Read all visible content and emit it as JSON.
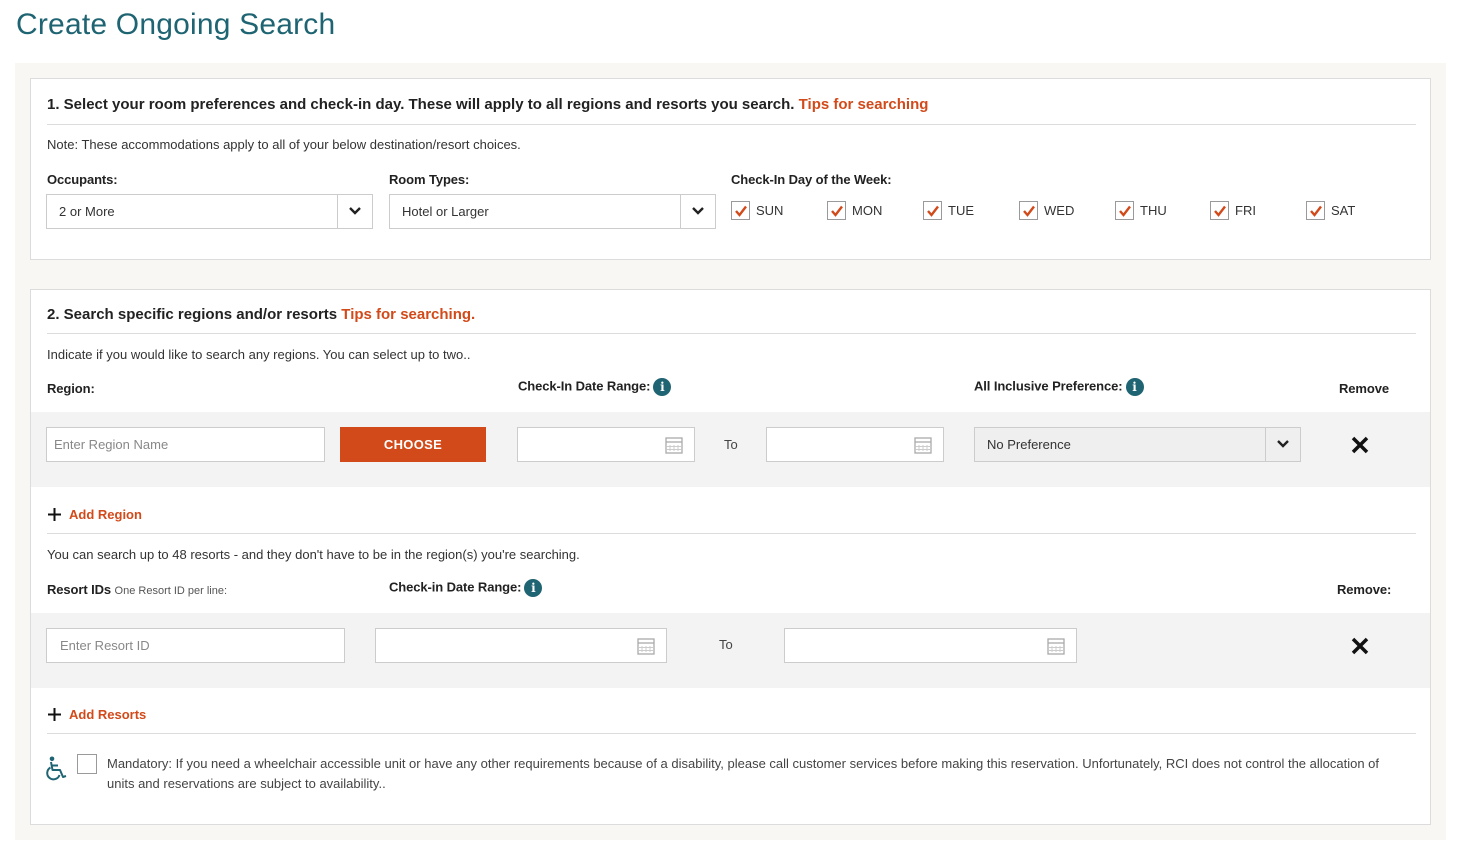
{
  "page": {
    "title": "Create Ongoing Search"
  },
  "section1": {
    "heading": "1. Select your room preferences and check-in day. These will apply to all regions and resorts you search.",
    "tips_link": "Tips for searching",
    "note": "Note: These accommodations apply to all of your below destination/resort choices.",
    "occupants": {
      "label": "Occupants:",
      "value": "2 or More"
    },
    "room_types": {
      "label": "Room Types:",
      "value": "Hotel or Larger"
    },
    "checkin_days": {
      "label": "Check-In Day of the Week:",
      "days": [
        {
          "label": "SUN",
          "checked": true
        },
        {
          "label": "MON",
          "checked": true
        },
        {
          "label": "TUE",
          "checked": true
        },
        {
          "label": "WED",
          "checked": true
        },
        {
          "label": "THU",
          "checked": true
        },
        {
          "label": "FRI",
          "checked": true
        },
        {
          "label": "SAT",
          "checked": true
        }
      ]
    }
  },
  "section2": {
    "heading": "2. Search specific regions and/or resorts",
    "tips_link": "Tips for searching.",
    "region_note": "Indicate if you would like to search any regions. You can select up to two..",
    "region_label": "Region:",
    "checkin_range_label": "Check-In Date Range:",
    "all_inclusive_label": "All Inclusive Preference:",
    "remove_label": "Remove",
    "region_placeholder": "Enter Region Name",
    "choose_button": "CHOOSE",
    "to_label": "To",
    "all_inclusive_value": "No Preference",
    "add_region": "Add Region",
    "resort_note": "You can search up to 48 resorts - and they don't have to be in the region(s) you're searching.",
    "resort_ids_label": "Resort IDs",
    "resort_ids_sub": "One Resort ID per line:",
    "resort_checkin_label": "Check-in Date Range:",
    "resort_remove_label": "Remove:",
    "resort_placeholder": "Enter Resort ID",
    "resort_to_label": "To",
    "add_resorts": "Add Resorts",
    "mandatory_text": "Mandatory: If you need a wheelchair accessible unit or have any other requirements because of a disability, please call customer services before making this reservation.  Unfortunately, RCI does not control the allocation of units and reservations are subject to availability.."
  },
  "colors": {
    "accent": "#d24a1a",
    "teal": "#1f6472"
  },
  "icons": {
    "info": "i",
    "remove": "close-icon",
    "calendar": "calendar-icon",
    "plus": "plus-icon",
    "wheelchair": "wheelchair-icon"
  }
}
